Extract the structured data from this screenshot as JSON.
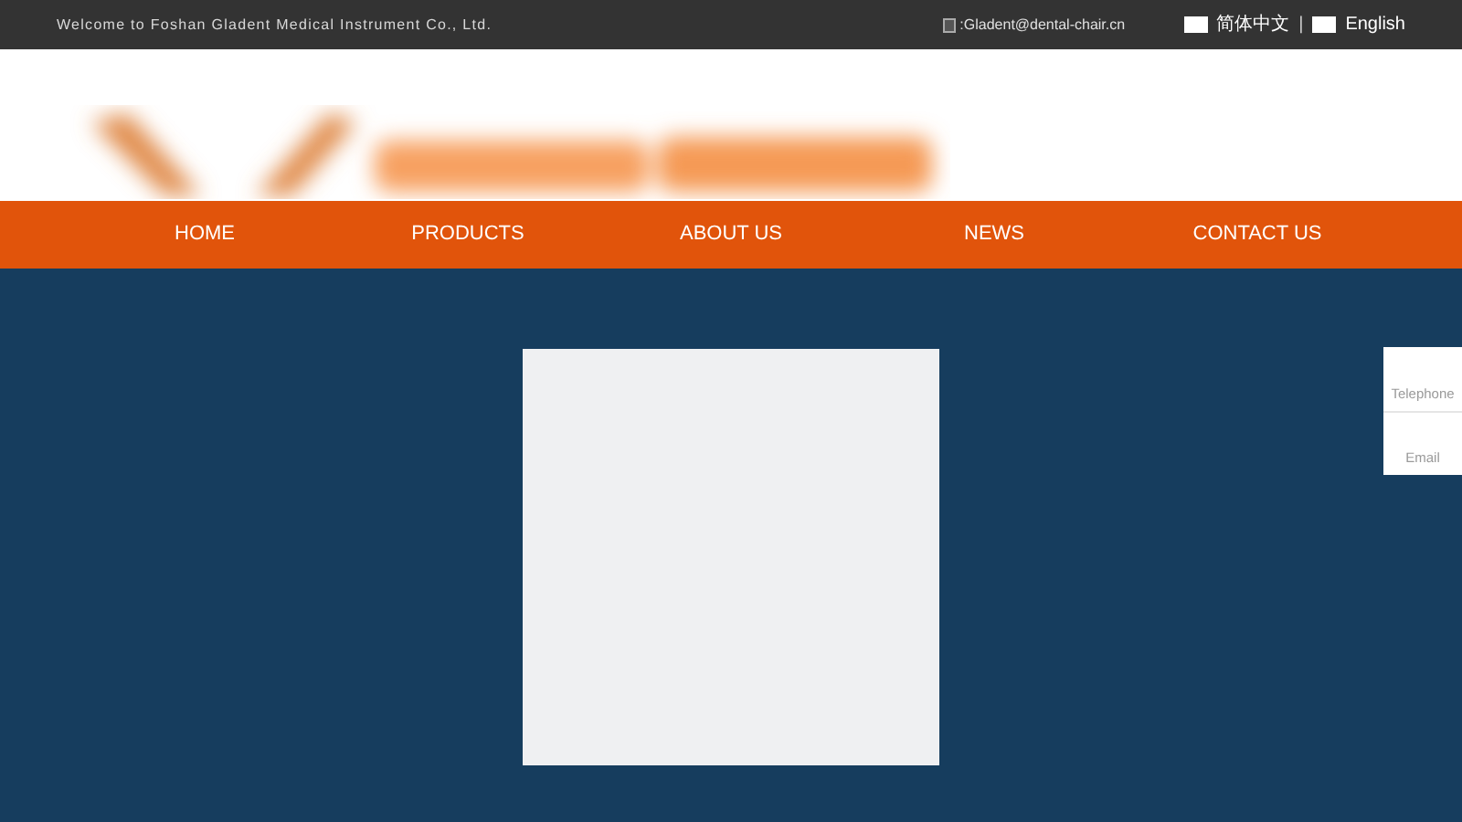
{
  "top_bar": {
    "welcome": "Welcome to Foshan Gladent Medical Instrument Co., Ltd.",
    "email": ":Gladent@dental-chair.cn",
    "languages": [
      {
        "label": "简体中文"
      },
      {
        "label": "English"
      }
    ],
    "separator": "|"
  },
  "nav": [
    {
      "label": "HOME"
    },
    {
      "label": "PRODUCTS"
    },
    {
      "label": "ABOUT US"
    },
    {
      "label": "NEWS"
    },
    {
      "label": "CONTACT US"
    }
  ],
  "side_contact": [
    {
      "label": "Telephone"
    },
    {
      "label": "Email"
    }
  ]
}
